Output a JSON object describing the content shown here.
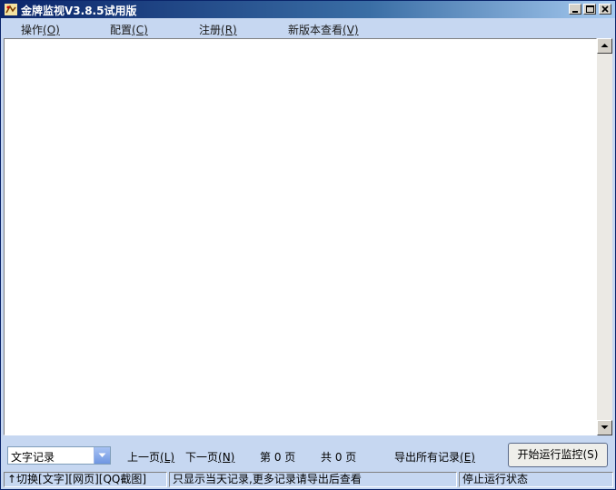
{
  "window": {
    "title": "金牌监视V3.8.5试用版",
    "icon": "app-logo-icon"
  },
  "menu": {
    "items": [
      {
        "label": "操作",
        "shortcut": "(O)"
      },
      {
        "label": "配置",
        "shortcut": "(C)"
      },
      {
        "label": "注册",
        "shortcut": "(R)"
      },
      {
        "label": "新版本查看",
        "shortcut": "(V)"
      }
    ]
  },
  "toolbar": {
    "record_type_value": "文字记录",
    "prev_page": {
      "label": "上一页",
      "shortcut": "(L)"
    },
    "next_page": {
      "label": "下一页",
      "shortcut": "(N)"
    },
    "page_current": "第 0 页",
    "page_total": "共 0 页",
    "export_all": {
      "label": "导出所有记录",
      "shortcut": "(E)"
    },
    "start_button": "开始运行监控(S)"
  },
  "status": {
    "toggle_hint": "↑切换[文字][网页][QQ截图]",
    "info": "只显示当天记录,更多记录请导出后查看",
    "state": "停止运行状态"
  },
  "colors": {
    "title_bar_start": "#0a246a",
    "frame": "#c6d7f1"
  }
}
